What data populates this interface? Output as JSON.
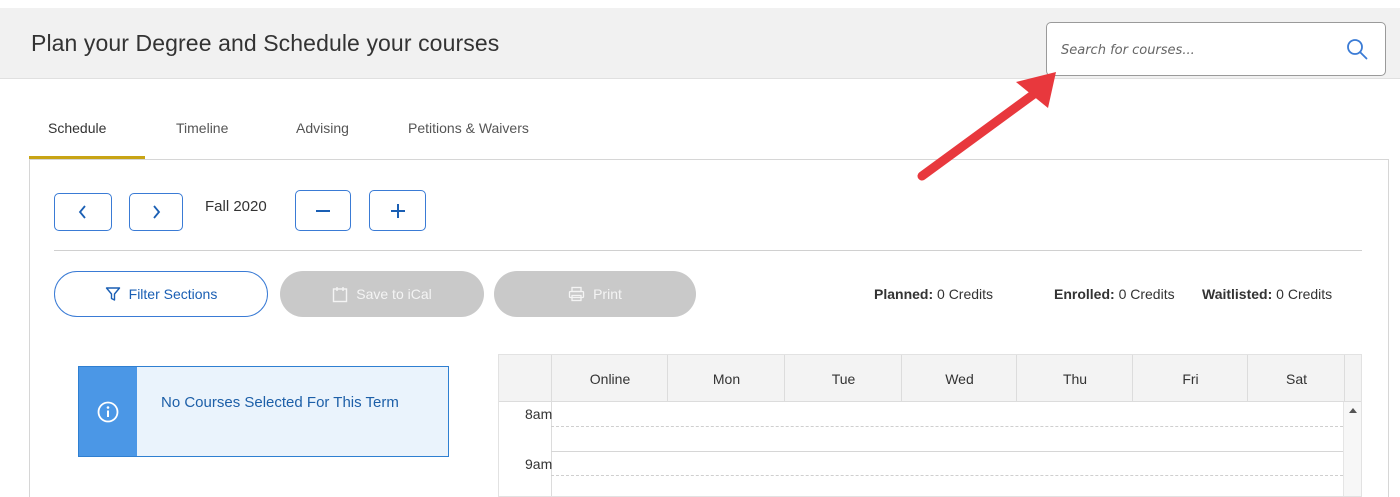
{
  "header": {
    "title": "Plan your Degree and Schedule your courses",
    "search_placeholder": "Search for courses..."
  },
  "tabs": [
    {
      "label": "Schedule",
      "active": true
    },
    {
      "label": "Timeline",
      "active": false
    },
    {
      "label": "Advising",
      "active": false
    },
    {
      "label": "Petitions & Waivers",
      "active": false
    }
  ],
  "term_nav": {
    "term_label": "Fall 2020"
  },
  "actions": {
    "filter_label": "Filter Sections",
    "ical_label": "Save to iCal",
    "print_label": "Print"
  },
  "credits": {
    "planned_label": "Planned:",
    "planned_value": "0 Credits",
    "enrolled_label": "Enrolled:",
    "enrolled_value": "0 Credits",
    "waitlisted_label": "Waitlisted:",
    "waitlisted_value": "0 Credits"
  },
  "notice": {
    "message": "No Courses Selected For This Term"
  },
  "calendar": {
    "days": [
      "Online",
      "Mon",
      "Tue",
      "Wed",
      "Thu",
      "Fri",
      "Sat"
    ],
    "times": [
      "8am",
      "9am"
    ]
  },
  "colors": {
    "accent_tab": "#c8a415",
    "primary": "#3a7bd5",
    "annotation_arrow": "#e8383d"
  }
}
